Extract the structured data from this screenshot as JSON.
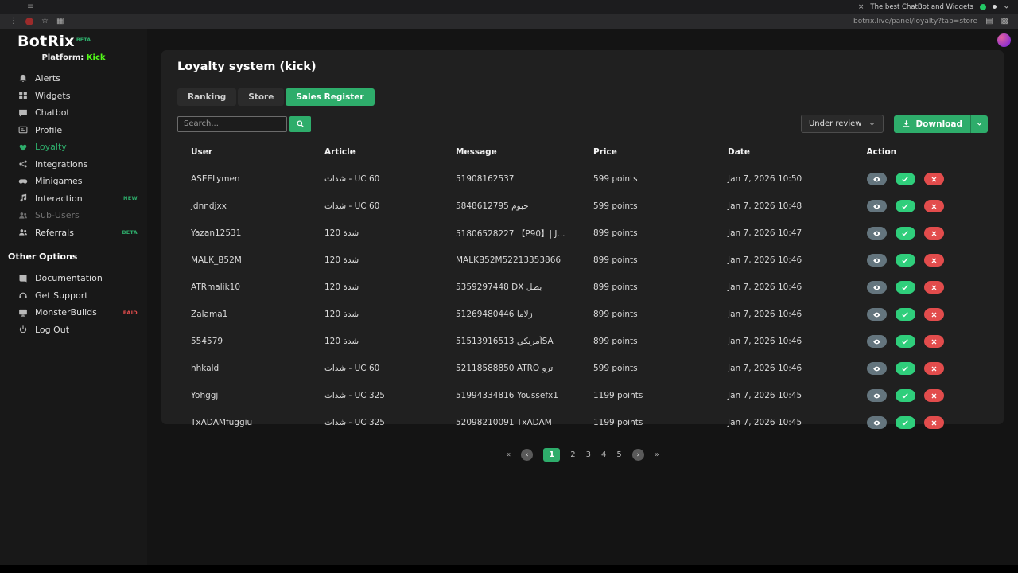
{
  "window": {
    "tab_title": "The best ChatBot and Widgets",
    "url": "botrix.live/panel/loyalty?tab=store"
  },
  "colors": {
    "accent": "#2ead6b",
    "success": "#2fce7b",
    "danger": "#e24c4c",
    "view": "#64757e",
    "kick_green": "#53fc18"
  },
  "sidebar": {
    "logo": "BotRix",
    "logo_badge": "BETA",
    "platform_label": "Platform:",
    "platform_value": "Kick",
    "items": [
      {
        "label": "Alerts",
        "icon": "bell"
      },
      {
        "label": "Widgets",
        "icon": "grid"
      },
      {
        "label": "Chatbot",
        "icon": "chat"
      },
      {
        "label": "Profile",
        "icon": "card"
      },
      {
        "label": "Loyalty",
        "icon": "heart",
        "active": true
      },
      {
        "label": "Integrations",
        "icon": "nodes"
      },
      {
        "label": "Minigames",
        "icon": "gamepad"
      },
      {
        "label": "Interaction",
        "icon": "note",
        "badge": "NEW"
      },
      {
        "label": "Sub-Users",
        "icon": "users",
        "disabled": true
      },
      {
        "label": "Referrals",
        "icon": "people",
        "badge": "BETA"
      }
    ],
    "section_label": "Other Options",
    "other_items": [
      {
        "label": "Documentation",
        "icon": "book"
      },
      {
        "label": "Get Support",
        "icon": "headset"
      },
      {
        "label": "MonsterBuilds",
        "icon": "monitor",
        "badge": "PAID",
        "badge_color": "#e24c4c"
      },
      {
        "label": "Log Out",
        "icon": "power"
      }
    ]
  },
  "main": {
    "title": "Loyalty system (kick)",
    "tabs": [
      {
        "label": "Ranking"
      },
      {
        "label": "Store"
      },
      {
        "label": "Sales Register",
        "active": true
      }
    ],
    "search": {
      "placeholder": "Search..."
    },
    "filter": {
      "value": "Under review"
    },
    "download": {
      "label": "Download"
    },
    "table": {
      "headers": [
        "User",
        "Article",
        "Message",
        "Price",
        "Date",
        "Action"
      ],
      "rows": [
        {
          "user": "ASEELymen",
          "article": "شدات - UC 60",
          "message": "51908162537",
          "price": "599 points",
          "date": "Jan 7, 2026 10:50"
        },
        {
          "user": "jdnndjxx",
          "article": "شدات - UC 60",
          "message": "5848612795 حبوم",
          "price": "599 points",
          "date": "Jan 7, 2026 10:48"
        },
        {
          "user": "Yazan12531",
          "article": "شدة 120",
          "message": "51806528227 【P90】| J...",
          "price": "899 points",
          "date": "Jan 7, 2026 10:47"
        },
        {
          "user": "MALK_B52M",
          "article": "شدة 120",
          "message": "MALKB52M52213353866",
          "price": "899 points",
          "date": "Jan 7, 2026 10:46"
        },
        {
          "user": "ATRmalik10",
          "article": "شدة 120",
          "message": "5359297448 DX بطل",
          "price": "899 points",
          "date": "Jan 7, 2026 10:46"
        },
        {
          "user": "Zalama1",
          "article": "شدة 120",
          "message": "51269480446 زلاما",
          "price": "899 points",
          "date": "Jan 7, 2026 10:46"
        },
        {
          "user": "554579",
          "article": "شدة 120",
          "message": "51513916513 آمريكيSA",
          "price": "899 points",
          "date": "Jan 7, 2026 10:46"
        },
        {
          "user": "hhkald",
          "article": "شدات - UC 60",
          "message": "52118588850 ATRO ترو",
          "price": "599 points",
          "date": "Jan 7, 2026 10:46"
        },
        {
          "user": "Yohggj",
          "article": "شدات - UC 325",
          "message": "51994334816 Youssefx1",
          "price": "1199 points",
          "date": "Jan 7, 2026 10:45"
        },
        {
          "user": "TxADAMfuggiu",
          "article": "شدات - UC 325",
          "message": "52098210091 TxADAM",
          "price": "1199 points",
          "date": "Jan 7, 2026 10:45"
        }
      ]
    },
    "pagination": {
      "first": "«",
      "prev": "‹",
      "pages": [
        "1",
        "2",
        "3",
        "4",
        "5"
      ],
      "active_page": "1",
      "next": "›",
      "last": "»"
    }
  }
}
